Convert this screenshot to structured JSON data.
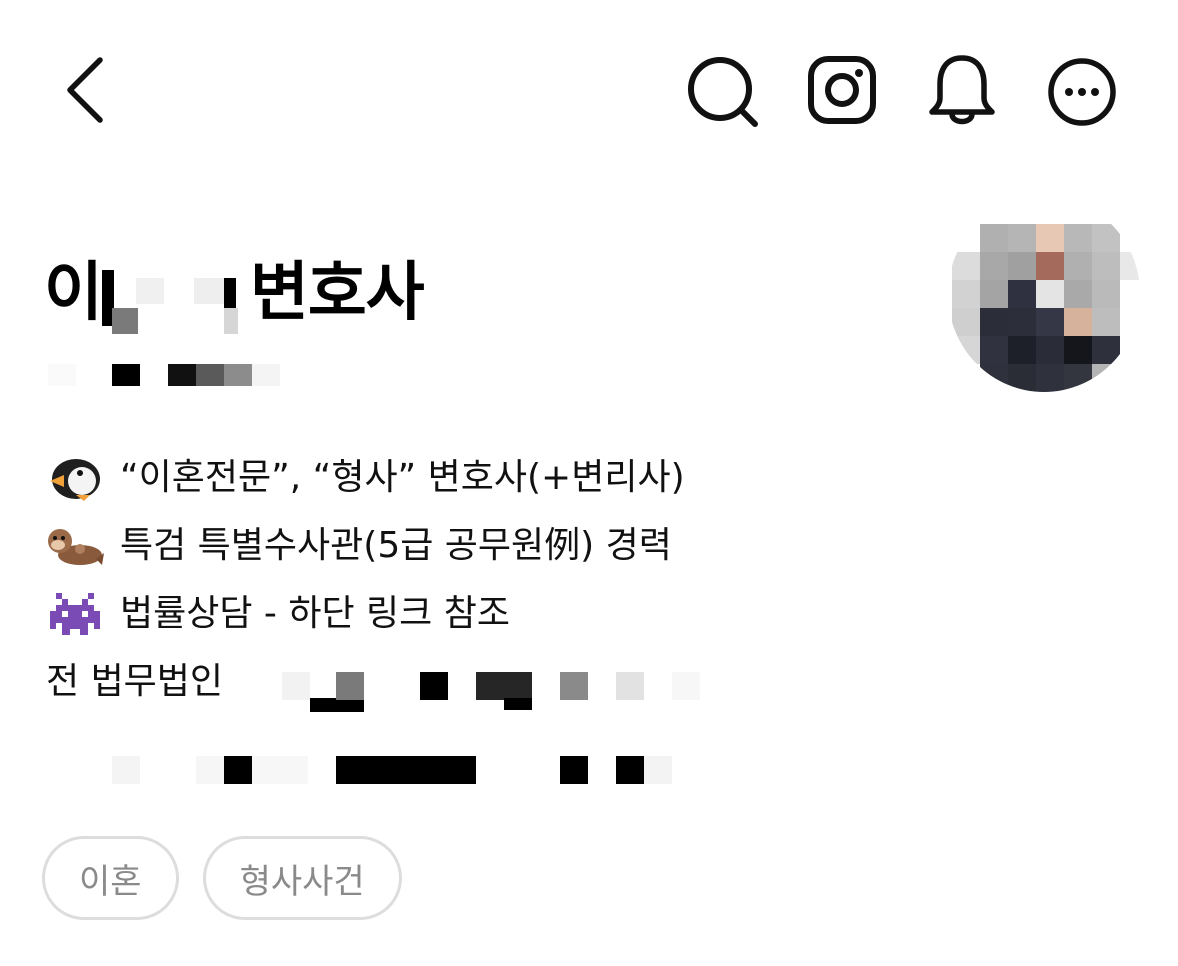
{
  "header": {
    "icons": [
      "back-icon",
      "search-icon",
      "instagram-icon",
      "bell-icon",
      "more-icon"
    ]
  },
  "profile": {
    "name_prefix": "이",
    "name_suffix": "변호사",
    "avatar": "profile-photo (pixelated)"
  },
  "bio": {
    "lines": [
      {
        "emoji": "penguin",
        "text": "“이혼전문”, “형사” 변호사(+변리사)"
      },
      {
        "emoji": "otter",
        "text": "특검 특별수사관(5급 공무원例) 경력"
      },
      {
        "emoji": "alien-monster",
        "text": "법률상담 - 하단 링크 참조"
      },
      {
        "emoji": "",
        "text": "전 법무법인"
      }
    ]
  },
  "tags": [
    "이혼",
    "형사사건"
  ],
  "colors": {
    "text": "#111111",
    "tag_border": "#dddddd",
    "tag_text": "#8a8a8a",
    "alien_purple": "#7b4bb5"
  }
}
